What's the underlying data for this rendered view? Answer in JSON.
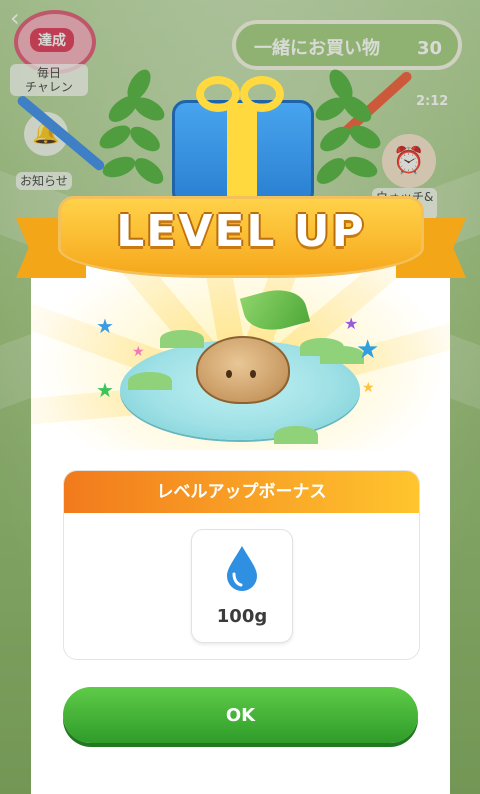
{
  "background": {
    "daily_badge": "達成",
    "daily_label": "毎日\nチャレン",
    "notice_label": "お知らせ",
    "shop_button": "一緒にお買い物",
    "shop_count": "30",
    "timer": "2:12",
    "watch_label": "ウォッチ&\nーナス"
  },
  "modal": {
    "title": "LEVEL UP",
    "bonus_header": "レベルアップボーナス",
    "reward": {
      "icon": "water-drop-icon",
      "amount": "100g"
    },
    "ok_label": "OK"
  },
  "colors": {
    "banner": "#f6a81c",
    "bonus_header_start": "#f27a1c",
    "bonus_header_end": "#ffc52e",
    "ok_button": "#3aae30",
    "water": "#2f8fe0"
  }
}
